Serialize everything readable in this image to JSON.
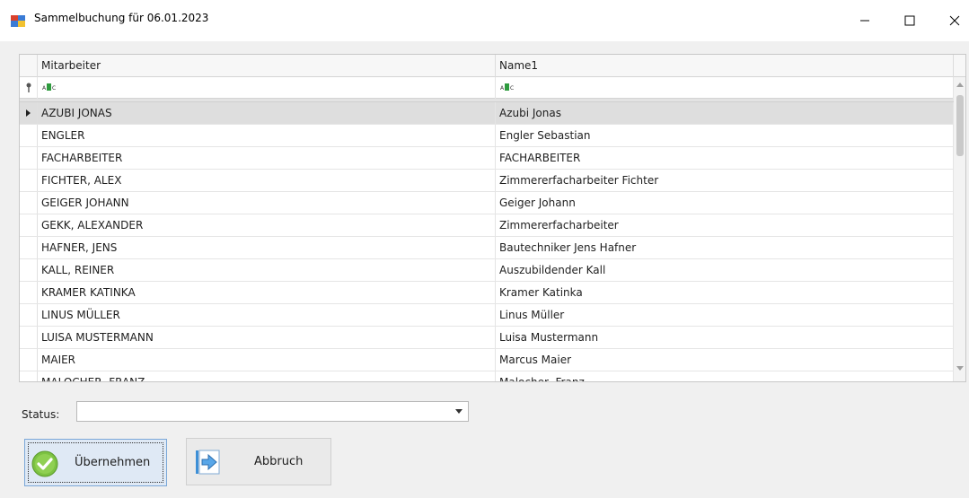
{
  "window": {
    "title": "Sammelbuchung für 06.01.2023"
  },
  "grid": {
    "columns": [
      "Mitarbeiter",
      "Name1"
    ],
    "filter_marker": "ABC",
    "rows": [
      {
        "mitarbeiter": "AZUBI JONAS",
        "name1": "Azubi Jonas",
        "selected": true
      },
      {
        "mitarbeiter": "ENGLER",
        "name1": "Engler Sebastian"
      },
      {
        "mitarbeiter": "FACHARBEITER",
        "name1": "FACHARBEITER"
      },
      {
        "mitarbeiter": "FICHTER, ALEX",
        "name1": "Zimmererfacharbeiter Fichter"
      },
      {
        "mitarbeiter": "GEIGER JOHANN",
        "name1": "Geiger Johann"
      },
      {
        "mitarbeiter": "GEKK, ALEXANDER",
        "name1": "Zimmererfacharbeiter"
      },
      {
        "mitarbeiter": "HAFNER, JENS",
        "name1": "Bautechniker Jens Hafner"
      },
      {
        "mitarbeiter": "KALL, REINER",
        "name1": "Auszubildender Kall"
      },
      {
        "mitarbeiter": "KRAMER KATINKA",
        "name1": "Kramer Katinka"
      },
      {
        "mitarbeiter": "LINUS MÜLLER",
        "name1": "Linus Müller"
      },
      {
        "mitarbeiter": "LUISA MUSTERMANN",
        "name1": "Luisa Mustermann"
      },
      {
        "mitarbeiter": "MAIER",
        "name1": "Marcus Maier"
      },
      {
        "mitarbeiter": "MALOCHER, FRANZ",
        "name1": "Malocher, Franz"
      }
    ]
  },
  "status": {
    "label": "Status:",
    "value": ""
  },
  "buttons": {
    "ok": "Übernehmen",
    "cancel": "Abbruch"
  },
  "colors": {
    "accent": "#7aa7d8",
    "selected_row": "#dedede",
    "ok_icon": "#7cc242",
    "cancel_icon": "#3d8fd6"
  },
  "icons": [
    "app-icon",
    "minimize-icon",
    "maximize-icon",
    "close-icon",
    "pin-icon",
    "row-pointer-icon",
    "checkmark-icon",
    "arrow-right-icon",
    "chevron-down-icon"
  ]
}
